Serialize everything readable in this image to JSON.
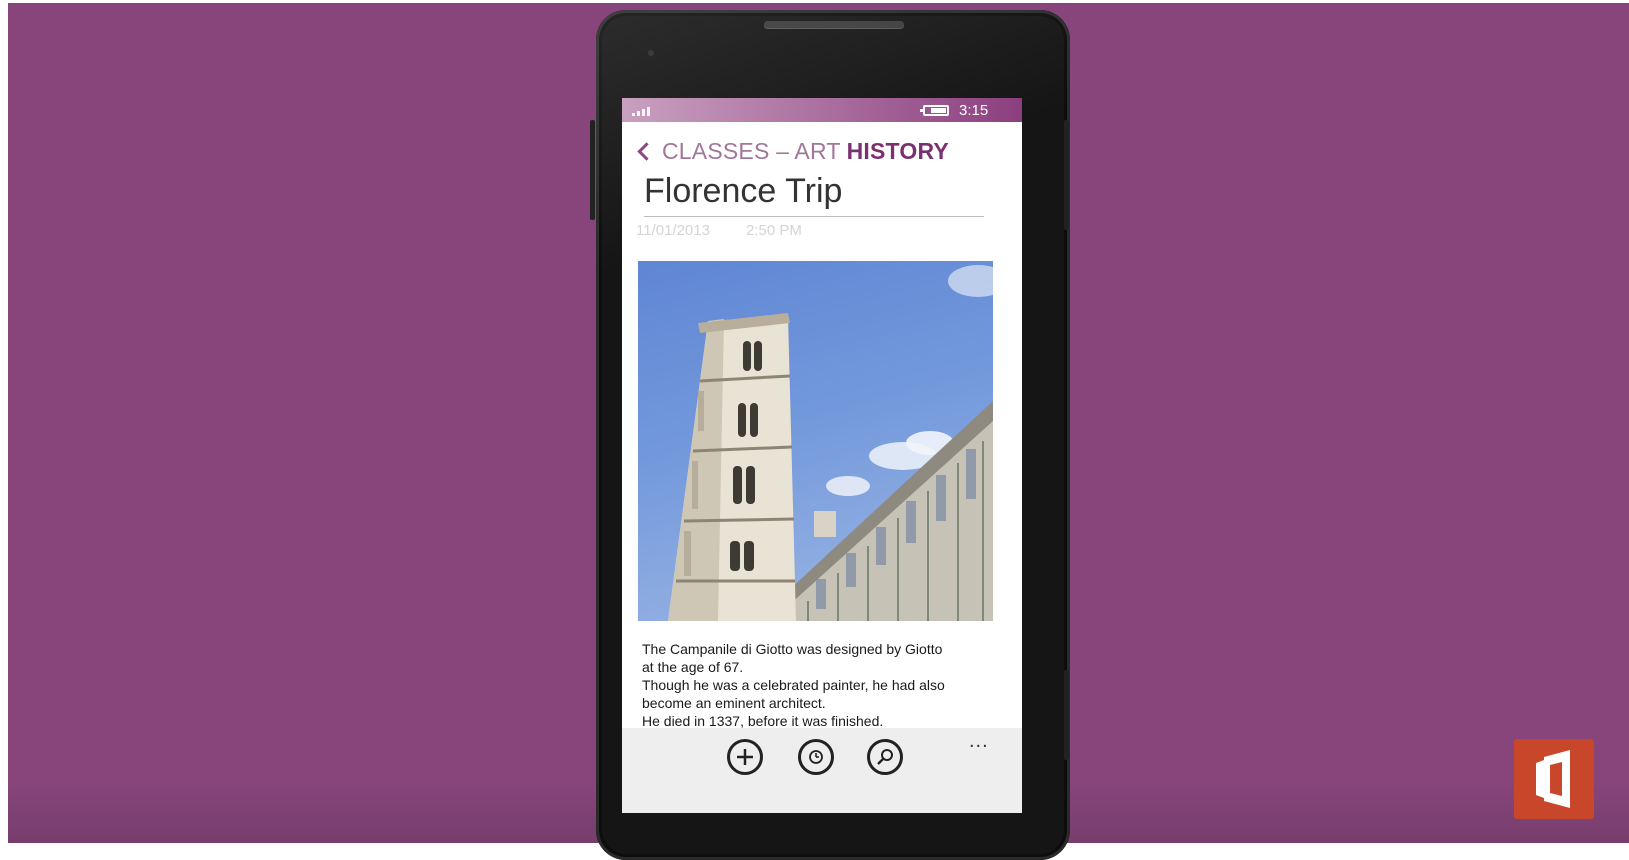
{
  "status_bar": {
    "time": "3:15",
    "signal_icon": "signal-icon",
    "battery_icon": "battery-icon"
  },
  "header": {
    "breadcrumb_parent": "CLASSES – ART",
    "breadcrumb_current": "HISTORY",
    "back_icon": "chevron-left-icon"
  },
  "page": {
    "title": "Florence Trip",
    "date": "11/01/2013",
    "time": "2:50 PM",
    "image_subject": "Campanile di Giotto",
    "body_lines": [
      "The Campanile di Giotto was designed by Giotto",
      "at the age of 67.",
      "Though he was a celebrated painter, he had also",
      "become an eminent architect.",
      "He died in 1337, before it was finished."
    ]
  },
  "app_bar": {
    "buttons": [
      {
        "name": "add-button",
        "icon": "plus-icon"
      },
      {
        "name": "recent-button",
        "icon": "clock-icon"
      },
      {
        "name": "search-button",
        "icon": "search-icon"
      }
    ],
    "more_label": "..."
  },
  "colors": {
    "background": "#87457b",
    "accent": "#7b3170",
    "brand_logo": "#c8462a"
  }
}
